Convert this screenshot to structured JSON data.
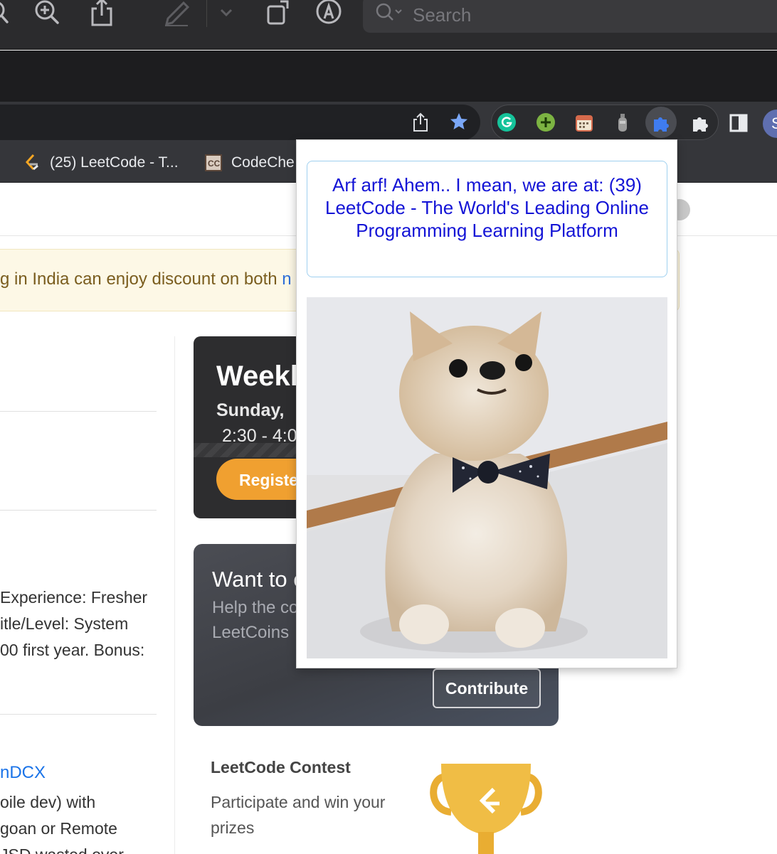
{
  "os_toolbar": {
    "icons": [
      "search-icon",
      "zoom-in-icon",
      "share-icon",
      "markup-pen-icon",
      "chevron-down-icon",
      "rotate-icon",
      "annotate-icon"
    ],
    "search_placeholder": "Search"
  },
  "chrome": {
    "address_icons": [
      "share-icon",
      "bookmark-star-icon"
    ],
    "extensions": [
      "grammarly-icon",
      "plus-extension-icon",
      "calendar-extension-icon",
      "bottle-extension-icon",
      "puzzle-extension-active-icon",
      "puzzle-menu-icon",
      "side-panel-icon"
    ],
    "profile_initial": "S"
  },
  "bookmarks": [
    {
      "label": "(25) LeetCode - T...",
      "icon": "leetcode-icon"
    },
    {
      "label": "CodeChe",
      "icon": "codechef-icon"
    }
  ],
  "page": {
    "notice_text": "g in India can enjoy discount on both ",
    "notice_link": "n",
    "weekly": {
      "title": "Weekl",
      "day": "Sunday,",
      "time": "2:30 - 4:0",
      "register": "Registe"
    },
    "left_text": [
      "Experience: Fresher",
      "itle/Level: System",
      "00 first year. Bonus:"
    ],
    "left_link": "nDCX",
    "left_text2": [
      "oile dev) with",
      "goan or Remote",
      "JSD wasted over"
    ],
    "contribute": {
      "title": "Want to c",
      "sub1": "Help the co",
      "sub2": "LeetCoins",
      "button": "Contribute"
    },
    "contest": {
      "title": "LeetCode Contest",
      "desc": "Participate and win your prizes"
    }
  },
  "popup": {
    "message": "Arf arf! Ahem.. I mean, we are at: (39) LeetCode - The World's Leading Online Programming Learning Platform",
    "photo": "pomeranian-dog-with-bow-tie"
  },
  "colors": {
    "popup_text": "#1414d6",
    "popup_border": "#9fd0ef",
    "register": "#f0a030",
    "link": "#1a73e8"
  }
}
